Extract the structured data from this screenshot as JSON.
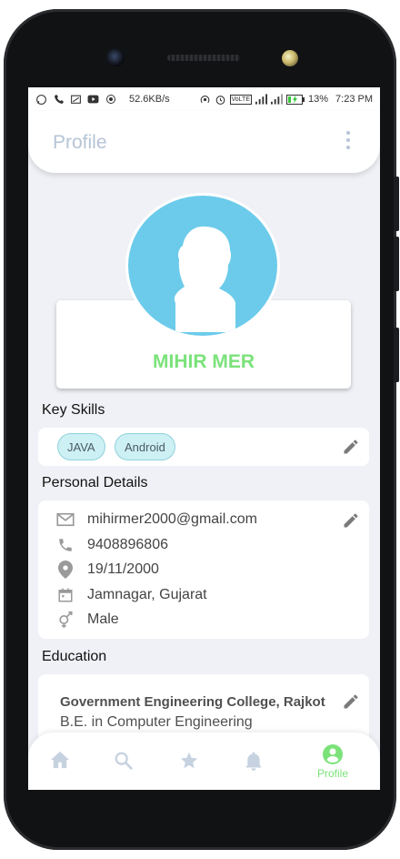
{
  "status_bar": {
    "speed": "52.6KB/s",
    "battery": "13%",
    "time": "7:23 PM",
    "network_badge": "VoLTE"
  },
  "appbar": {
    "title": "Profile"
  },
  "profile": {
    "name": "MIHIR MER"
  },
  "sections": {
    "key_skills": "Key Skills",
    "personal_details": "Personal Details",
    "education": "Education"
  },
  "skills": [
    "JAVA",
    "Android"
  ],
  "personal": {
    "email": "mihirmer2000@gmail.com",
    "phone": "9408896806",
    "dob": "19/11/2000",
    "location": "Jamnagar, Gujarat",
    "gender": "Male"
  },
  "education": {
    "college": "Government Engineering College, Rajkot",
    "degree": "B.E. in Computer Engineering"
  },
  "bottom_nav": {
    "items": [
      "home",
      "search",
      "star",
      "notifications",
      "profile"
    ],
    "active_label": "Profile"
  },
  "colors": {
    "accent_green": "#7be27a",
    "avatar_blue": "#6ccbea",
    "title_blue_grey": "#b6c4d6",
    "chip_bg": "#cdf0f4"
  }
}
